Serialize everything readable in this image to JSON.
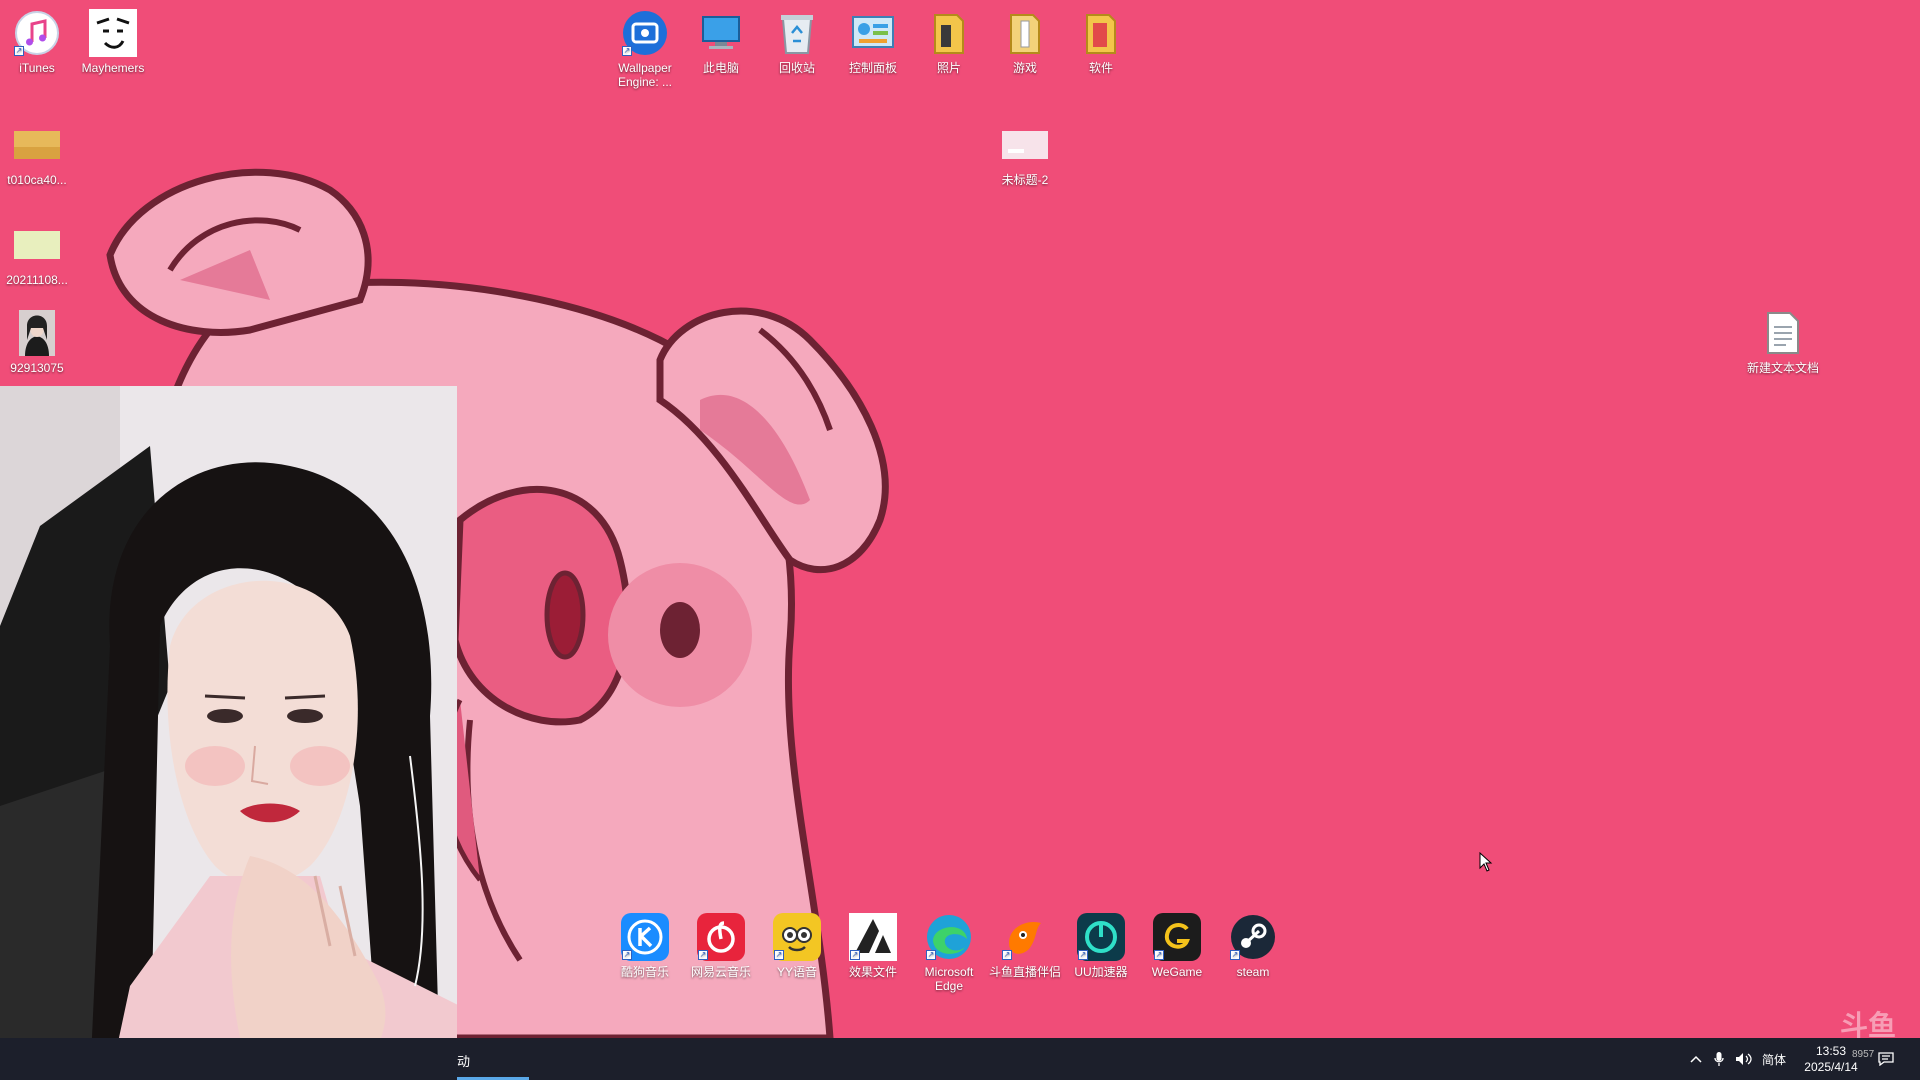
{
  "desktop": {
    "icons_top": [
      {
        "name": "itunes-icon",
        "label": "iTunes"
      },
      {
        "name": "mayhemers-icon",
        "label": "Mayhemers"
      },
      {
        "name": "wallpaper-engine-icon",
        "label": "Wallpaper Engine: ..."
      },
      {
        "name": "this-pc-icon",
        "label": "此电脑"
      },
      {
        "name": "recycle-bin-icon",
        "label": "回收站"
      },
      {
        "name": "control-panel-icon",
        "label": "控制面板"
      },
      {
        "name": "folder-photos-icon",
        "label": "照片"
      },
      {
        "name": "folder-games-icon",
        "label": "游戏"
      },
      {
        "name": "folder-software-icon",
        "label": "软件"
      }
    ],
    "icons_left": [
      {
        "name": "image-file-icon",
        "label": "t010ca40..."
      },
      {
        "name": "image-file-icon",
        "label": "20211108..."
      },
      {
        "name": "photo-file-icon",
        "label": "92913075"
      }
    ],
    "untitled_icon": {
      "label": "未标题-2"
    },
    "text_doc_icon": {
      "label": "新建文本文档"
    },
    "icons_bottom": [
      {
        "name": "kugou-music-icon",
        "label": "酷狗音乐",
        "color": "#1a8cff"
      },
      {
        "name": "netease-music-icon",
        "label": "网易云音乐",
        "color": "#e8243c"
      },
      {
        "name": "yy-voice-icon",
        "label": "YY语音",
        "color": "#f3c623"
      },
      {
        "name": "effects-folder-icon",
        "label": "效果文件",
        "color": "#222222"
      },
      {
        "name": "microsoft-edge-icon",
        "label": "Microsoft Edge",
        "color": "#1fa2d8"
      },
      {
        "name": "douyu-companion-icon",
        "label": "斗鱼直播伴侣",
        "color": "#ff7a00"
      },
      {
        "name": "uu-accelerator-icon",
        "label": "UU加速器",
        "color": "#0c3b4a"
      },
      {
        "name": "wegame-icon",
        "label": "WeGame",
        "color": "#1c1c1c"
      },
      {
        "name": "steam-icon",
        "label": "steam",
        "color": "#1b2838"
      }
    ]
  },
  "taskbar": {
    "app_label": "动",
    "tray": {
      "ime": "简体",
      "time": "13:53",
      "date": "2025/4/14",
      "extra": "8957"
    }
  },
  "watermark": "斗鱼"
}
